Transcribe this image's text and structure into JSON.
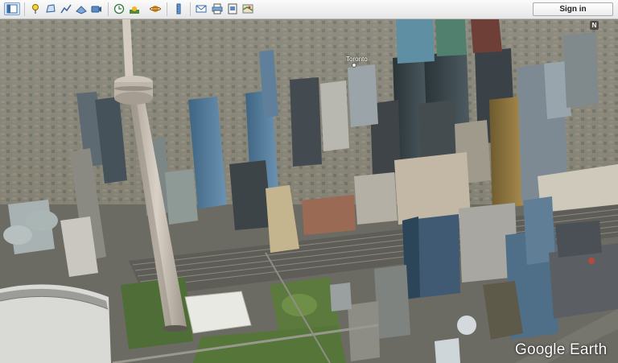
{
  "toolbar": {
    "buttons": [
      {
        "name": "sidebar-toggle-button",
        "icon": "sidebar-icon",
        "active": true
      },
      {
        "name": "add-placemark-button",
        "icon": "pushpin-icon"
      },
      {
        "name": "add-polygon-button",
        "icon": "polygon-icon"
      },
      {
        "name": "add-path-button",
        "icon": "path-icon"
      },
      {
        "name": "add-image-overlay-button",
        "icon": "image-overlay-icon"
      },
      {
        "name": "record-tour-button",
        "icon": "record-tour-icon"
      },
      {
        "name": "historical-imagery-button",
        "icon": "clock-icon"
      },
      {
        "name": "sunlight-button",
        "icon": "sun-icon"
      },
      {
        "name": "switch-to-sky-button",
        "icon": "planet-icon"
      },
      {
        "name": "ruler-button",
        "icon": "ruler-icon"
      },
      {
        "name": "email-button",
        "icon": "envelope-icon"
      },
      {
        "name": "print-button",
        "icon": "printer-icon"
      },
      {
        "name": "save-image-button",
        "icon": "save-image-icon"
      },
      {
        "name": "view-in-maps-button",
        "icon": "maps-icon"
      }
    ],
    "sign_in_label": "Sign in"
  },
  "map": {
    "place_label": "Toronto",
    "compass_letter": "N",
    "logo_text": "Google Earth"
  },
  "colors": {
    "toolbar_bg": "#ececec",
    "tower": "#c9bfb3",
    "glass_tower": "#4a6d8c",
    "dark_tower": "#2f3a3f",
    "park": "#5c7a3e"
  }
}
